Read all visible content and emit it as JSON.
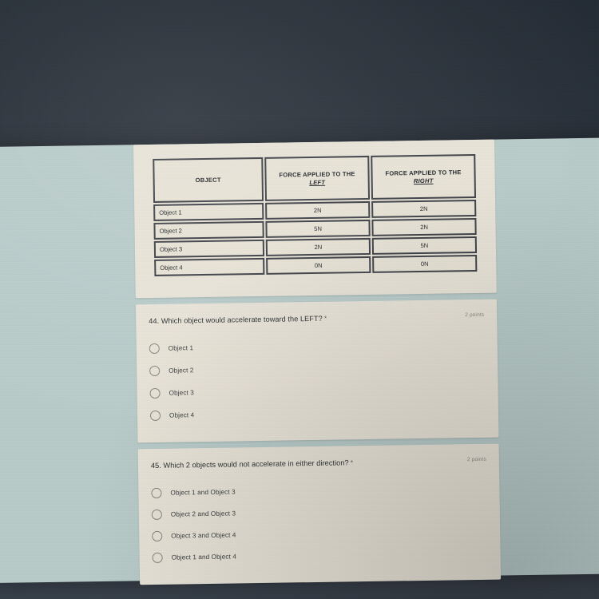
{
  "screen": {
    "background_color": "#b9ccca",
    "bezel_color": "#2e3640",
    "card_color": "#e9e4d8"
  },
  "image_card": {
    "table": {
      "headers": [
        {
          "line1": "OBJECT",
          "line2": "",
          "underlined": ""
        },
        {
          "line1": "FORCE APPLIED TO THE",
          "line2": "",
          "underlined": "LEFT"
        },
        {
          "line1": "FORCE APPLIED TO THE",
          "line2": "",
          "underlined": "RIGHT"
        }
      ],
      "rows": [
        {
          "object": "Object 1",
          "left": "2N",
          "right": "2N"
        },
        {
          "object": "Object 2",
          "left": "5N",
          "right": "2N"
        },
        {
          "object": "Object 3",
          "left": "2N",
          "right": "5N"
        },
        {
          "object": "Object 4",
          "left": "0N",
          "right": "0N"
        }
      ]
    }
  },
  "questions": [
    {
      "number": "44.",
      "text": "Which object would accelerate toward the LEFT?",
      "required_marker": "*",
      "points": "2 points",
      "options": [
        {
          "label": "Object 1",
          "selected": false
        },
        {
          "label": "Object 2",
          "selected": false
        },
        {
          "label": "Object 3",
          "selected": false
        },
        {
          "label": "Object 4",
          "selected": false
        }
      ]
    },
    {
      "number": "45.",
      "text": "Which 2 objects would not accelerate in either direction?",
      "required_marker": "*",
      "points": "2 points",
      "options": [
        {
          "label": "Object 1 and Object 3",
          "selected": false
        },
        {
          "label": "Object 2 and Object 3",
          "selected": false
        },
        {
          "label": "Object 3 and Object 4",
          "selected": false
        },
        {
          "label": "Object 1 and Object 4",
          "selected": false
        }
      ]
    }
  ]
}
